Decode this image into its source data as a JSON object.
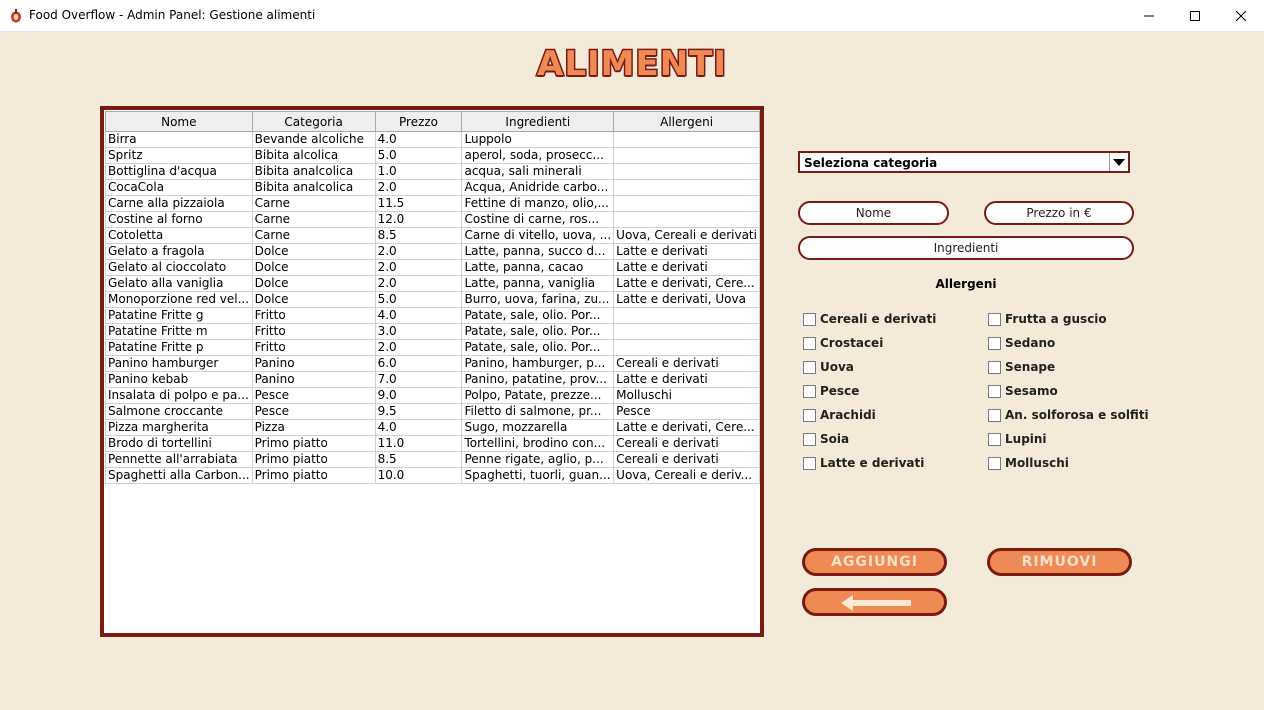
{
  "window": {
    "title": "Food Overflow - Admin Panel: Gestione alimenti",
    "icons": [
      "app-icon",
      "minimize-icon",
      "maximize-icon",
      "close-icon"
    ]
  },
  "header": {
    "title": "ALIMENTI"
  },
  "table": {
    "columns": [
      "Nome",
      "Categoria",
      "Prezzo",
      "Ingredienti",
      "Allergeni"
    ],
    "rows": [
      [
        "Birra",
        "Bevande alcoliche",
        "4.0",
        "Luppolo",
        ""
      ],
      [
        "Spritz",
        "Bibita alcolica",
        "5.0",
        "aperol, soda, prosecc...",
        ""
      ],
      [
        "Bottiglina d'acqua",
        "Bibita analcolica",
        "1.0",
        "acqua, sali minerali",
        ""
      ],
      [
        "CocaCola",
        "Bibita analcolica",
        "2.0",
        "Acqua, Anidride carbo...",
        ""
      ],
      [
        "Carne alla pizzaiola",
        "Carne",
        "11.5",
        "Fettine di manzo, olio,...",
        ""
      ],
      [
        "Costine al forno",
        "Carne",
        "12.0",
        "Costine di carne, ros...",
        ""
      ],
      [
        "Cotoletta",
        "Carne",
        "8.5",
        "Carne di vitello, uova, ...",
        "Uova, Cereali e derivati"
      ],
      [
        "Gelato a fragola",
        "Dolce",
        "2.0",
        "Latte, panna, succo d...",
        "Latte e derivati"
      ],
      [
        "Gelato al cioccolato",
        "Dolce",
        "2.0",
        "Latte, panna, cacao",
        "Latte e derivati"
      ],
      [
        "Gelato alla vaniglia",
        "Dolce",
        "2.0",
        "Latte, panna, vaniglia",
        "Latte e derivati, Cere..."
      ],
      [
        "Monoporzione red vel...",
        "Dolce",
        "5.0",
        "Burro, uova, farina, zu...",
        "Latte e derivati, Uova"
      ],
      [
        "Patatine Fritte g",
        "Fritto",
        "4.0",
        "Patate, sale, olio. Por...",
        ""
      ],
      [
        "Patatine Fritte m",
        "Fritto",
        "3.0",
        "Patate, sale, olio. Por...",
        ""
      ],
      [
        "Patatine Fritte p",
        "Fritto",
        "2.0",
        "Patate, sale, olio. Por...",
        ""
      ],
      [
        "Panino hamburger",
        "Panino",
        "6.0",
        "Panino, hamburger, p...",
        "Cereali e derivati"
      ],
      [
        "Panino kebab",
        "Panino",
        "7.0",
        "Panino, patatine, prov...",
        "Latte e derivati"
      ],
      [
        "Insalata di polpo e pa...",
        "Pesce",
        "9.0",
        "Polpo, Patate, prezze...",
        "Molluschi"
      ],
      [
        "Salmone croccante",
        "Pesce",
        "9.5",
        "Filetto di salmone, pr...",
        "Pesce"
      ],
      [
        "Pizza margherita",
        "Pizza",
        "4.0",
        "Sugo, mozzarella",
        "Latte e derivati, Cere..."
      ],
      [
        "Brodo di tortellini",
        "Primo piatto",
        "11.0",
        "Tortellini, brodino con...",
        "Cereali e derivati"
      ],
      [
        "Pennette all'arrabiata",
        "Primo piatto",
        "8.5",
        "Penne rigate, aglio, p...",
        "Cereali e derivati"
      ],
      [
        "Spaghetti alla Carbon...",
        "Primo piatto",
        "10.0",
        "Spaghetti, tuorli, guan...",
        "Uova, Cereali e deriv..."
      ]
    ]
  },
  "form": {
    "category_select": "Seleziona categoria",
    "name_field": "Nome",
    "price_field": "Prezzo in €",
    "ingredients_field": "Ingredienti",
    "allergens_label": "Allergeni",
    "allergens_left": [
      "Cereali e derivati",
      "Crostacei",
      "Uova",
      "Pesce",
      "Arachidi",
      "Soia",
      "Latte e derivati"
    ],
    "allergens_right": [
      "Frutta a guscio",
      "Sedano",
      "Senape",
      "Sesamo",
      "An. solforosa e solfiti",
      "Lupini",
      "Molluschi"
    ]
  },
  "actions": {
    "add_label": "AGGIUNGI",
    "remove_label": "RIMUOVI",
    "back_icon": "arrow-left-icon"
  },
  "colors": {
    "background": "#f3ead9",
    "accent": "#f08a55",
    "border": "#7a1b12"
  }
}
